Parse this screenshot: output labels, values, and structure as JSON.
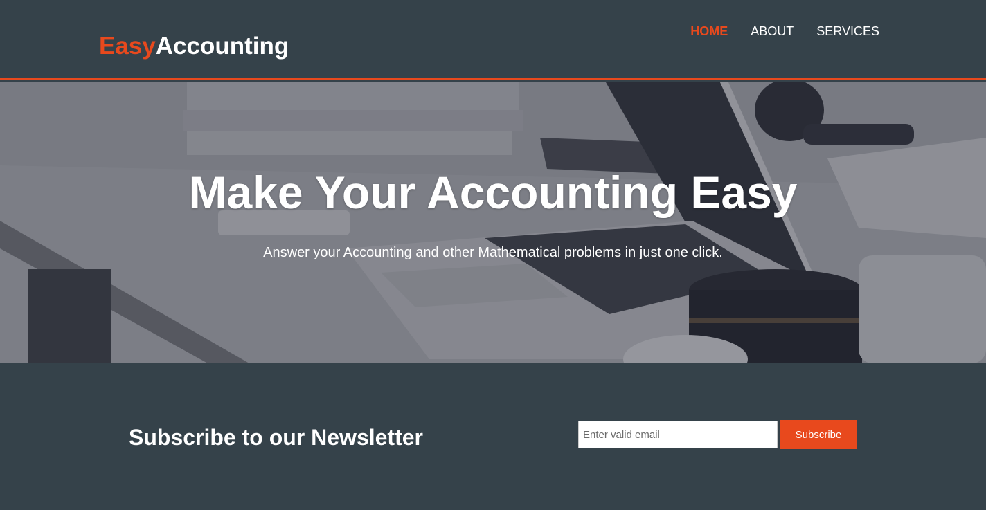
{
  "brand": {
    "highlight": "Easy",
    "rest": "Accounting"
  },
  "nav": {
    "items": [
      {
        "label": "HOME",
        "active": true
      },
      {
        "label": "ABOUT",
        "active": false
      },
      {
        "label": "SERVICES",
        "active": false
      }
    ]
  },
  "hero": {
    "title": "Make Your Accounting Easy",
    "subtitle": "Answer your Accounting and other Mathematical problems in just one click."
  },
  "newsletter": {
    "title": "Subscribe to our Newsletter",
    "email_placeholder": "Enter valid email",
    "email_value": "",
    "button_label": "Subscribe"
  },
  "colors": {
    "accent": "#e8491d",
    "dark_bg": "#35424a",
    "text": "#ffffff"
  }
}
